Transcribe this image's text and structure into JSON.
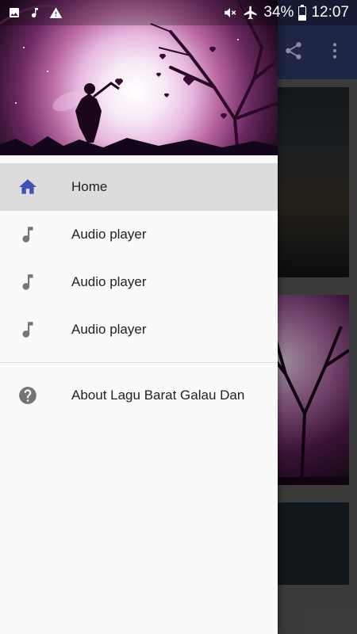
{
  "status_bar": {
    "battery_percent": "34%",
    "time": "12:07",
    "left_icons": [
      "image-icon",
      "music-note-icon",
      "warning-icon"
    ],
    "right_icons": [
      "mute-icon",
      "airplane-icon",
      "battery-icon"
    ]
  },
  "app_bar": {
    "actions": [
      "share-icon",
      "more-vert-icon"
    ],
    "color": "#2f3a6b"
  },
  "drawer": {
    "menu_items": [
      {
        "label": "Home",
        "icon": "home-icon",
        "active": true
      },
      {
        "label": "Audio player",
        "icon": "music-note-icon",
        "active": false
      },
      {
        "label": "Audio player",
        "icon": "music-note-icon",
        "active": false
      },
      {
        "label": "Audio player",
        "icon": "music-note-icon",
        "active": false
      }
    ],
    "secondary_items": [
      {
        "label": "About Lagu Barat Galau Dan",
        "icon": "help-icon"
      }
    ],
    "accent_color": "#3f51b5",
    "icon_color": "#757575"
  }
}
